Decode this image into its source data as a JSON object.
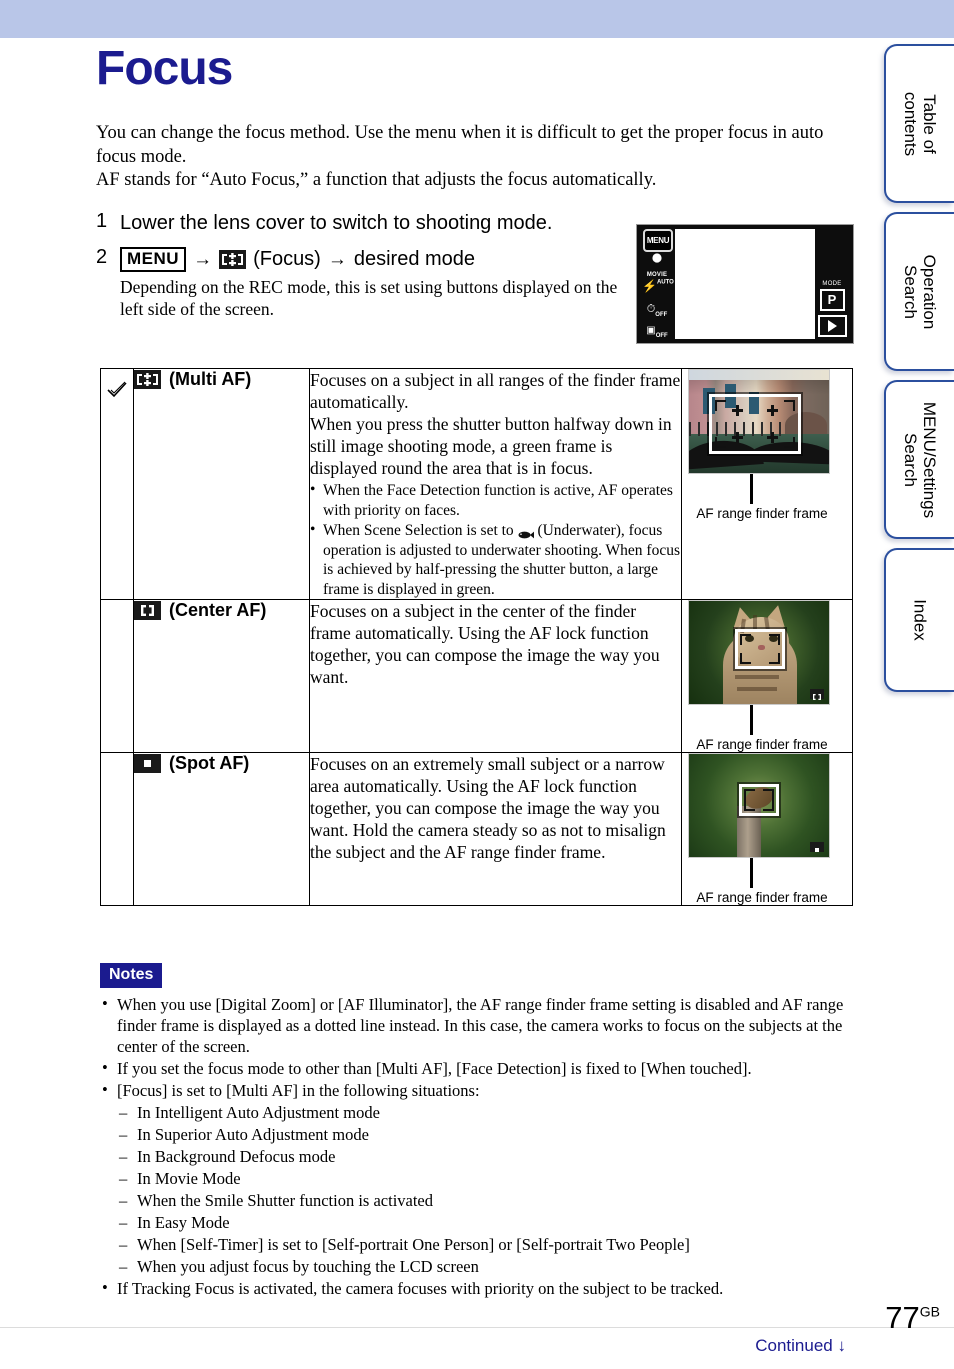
{
  "header": {
    "band_color": "#b9c6e8"
  },
  "tabs": [
    {
      "label": "Table of\ncontents",
      "name": "table-of-contents"
    },
    {
      "label": "Operation\nSearch",
      "name": "operation-search"
    },
    {
      "label": "MENU/Settings\nSearch",
      "name": "menu-settings-search"
    },
    {
      "label": "Index",
      "name": "index"
    }
  ],
  "page": {
    "title": "Focus",
    "title_color": "#1b1b8f",
    "intro": "You can change the focus method. Use the menu when it is difficult to get the proper focus in auto focus mode.\nAF stands for “Auto Focus,” a function that adjusts the focus automatically."
  },
  "steps": [
    {
      "number": "1",
      "text": "Lower the lens cover to switch to shooting mode.",
      "sub": ""
    },
    {
      "number": "2",
      "menu_chip": "MENU",
      "arrow": "→",
      "focus_label": "(Focus)",
      "tail": "desired mode",
      "sub": "Depending on the REC mode, this is set using buttons displayed on the left side of the screen."
    }
  ],
  "lcd": {
    "menu_button": "MENU",
    "movie_label": "MOVIE",
    "flash_label": "AUTO",
    "selftimer_label": "OFF",
    "burst_label": "OFF",
    "mode_label": "MODE",
    "mode_value": "P"
  },
  "table": {
    "rows": [
      {
        "checked": true,
        "check_symbol": "✓",
        "icon": "multi-af-icon",
        "mode": "(Multi AF)",
        "description": "Focuses on a subject in all ranges of the finder frame automatically.\nWhen you press the shutter button halfway down in still image shooting mode, a green frame is displayed round the area that is in focus.",
        "bullets": [
          "When the Face Detection function is active, AF operates with priority on faces.",
          "When Scene Selection is set to ◀ (Underwater), focus operation is adjusted to underwater shooting. When focus is achieved by half-pressing the shutter button, a large frame is displayed in green."
        ],
        "bullet_parts": [
          {
            "pre": "When the Face Detection function is active, AF operates with priority on faces.",
            "icon": "",
            "post": ""
          },
          {
            "pre": "When Scene Selection is set to ",
            "icon": "fish-icon",
            "post": " (Underwater), focus operation is adjusted to underwater shooting. When focus is achieved by half-pressing the shutter button, a large frame is displayed in green."
          }
        ],
        "image": "venice-canal-gondolas",
        "caption": "AF range finder frame"
      },
      {
        "checked": false,
        "check_symbol": "",
        "icon": "center-af-icon",
        "mode": "(Center AF)",
        "description": "Focuses on a subject in the center of the finder frame automatically. Using the AF lock function together, you can compose the image the way you want.",
        "bullets": [],
        "bullet_parts": [],
        "image": "tabby-cat",
        "caption": "AF range finder frame"
      },
      {
        "checked": false,
        "check_symbol": "",
        "icon": "spot-af-icon",
        "mode": "(Spot AF)",
        "description": "Focuses on an extremely small subject or a narrow area automatically. Using the AF lock function together, you can compose the image the way you want. Hold the camera steady so as not to misalign the subject and the AF range finder frame.",
        "bullets": [],
        "bullet_parts": [],
        "image": "bird-on-post",
        "caption": "AF range finder frame"
      }
    ]
  },
  "notes": {
    "badge": "Notes",
    "badge_color": "#1b1b8f",
    "items": [
      {
        "text": "When you use [Digital Zoom] or [AF Illuminator], the AF range finder frame setting is disabled and AF range finder frame is displayed as a dotted line instead. In this case, the camera works to focus on the subjects at the center of the screen.",
        "sub": []
      },
      {
        "text": "If you set the focus mode to other than [Multi AF], [Face Detection] is fixed to [When touched].",
        "sub": []
      },
      {
        "text": "[Focus] is set to [Multi AF] in the following situations:",
        "sub": [
          "In Intelligent Auto Adjustment mode",
          "In Superior Auto Adjustment mode",
          "In Background Defocus mode",
          "In Movie Mode",
          "When the Smile Shutter function is activated",
          "In Easy Mode",
          "When [Self-Timer] is set to [Self-portrait One Person] or [Self-portrait Two People]",
          "When you adjust focus by touching the LCD screen"
        ]
      },
      {
        "text": "If Tracking Focus is activated, the camera focuses with priority on the subject to be tracked.",
        "sub": []
      }
    ]
  },
  "footer": {
    "page_number": "77",
    "page_suffix": "GB",
    "continued": "Continued",
    "continued_arrow": "↓",
    "continued_color": "#1b1b8f"
  }
}
